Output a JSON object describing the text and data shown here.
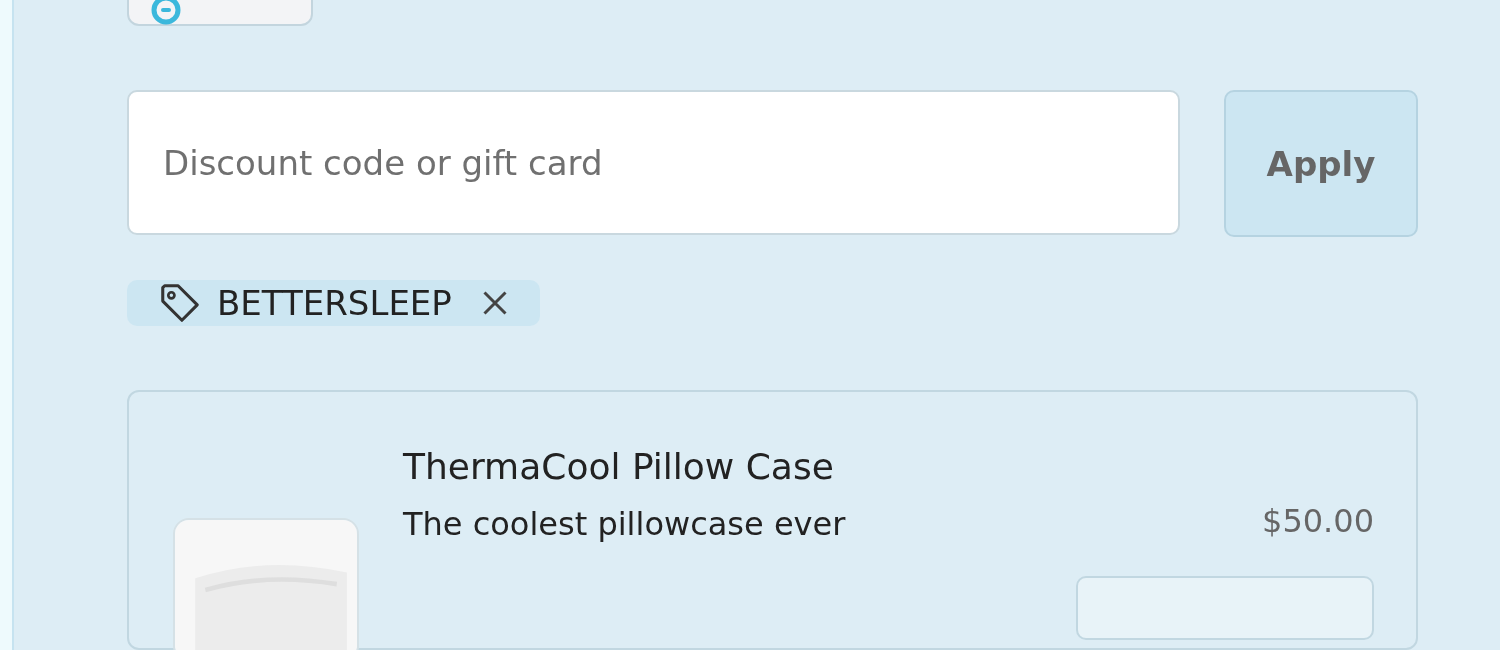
{
  "discount": {
    "placeholder": "Discount code or gift card",
    "apply_label": "Apply"
  },
  "applied_code": {
    "code": "BETTERSLEEP"
  },
  "line_item": {
    "name": "ThermaCool Pillow Case",
    "description": "The coolest pillowcase ever",
    "price": "$50.00"
  }
}
